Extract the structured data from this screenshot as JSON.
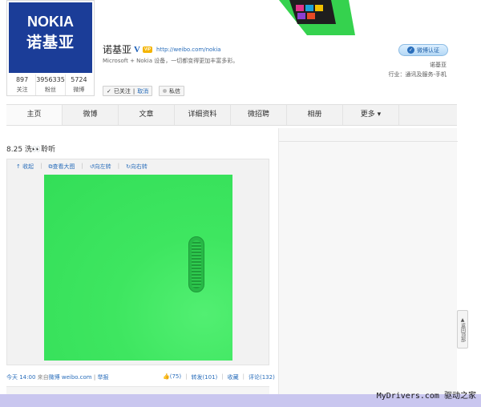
{
  "profile": {
    "logo_en": "NOKIA",
    "logo_cn": "诺基亚",
    "name": "诺基亚",
    "verified_icon": "V",
    "vip_label": "VIP",
    "url": "http://weibo.com/nokia",
    "description": "Microsoft + Nokia 设备，一切都变得更加丰富多彩。",
    "stats": [
      {
        "num": "897",
        "label": "关注"
      },
      {
        "num": "3956335",
        "label": "粉丝"
      },
      {
        "num": "5724",
        "label": "微博"
      }
    ],
    "follow_label": "已关注",
    "cancel_label": "取消",
    "message_label": "私信",
    "verify_badge": "微博认证",
    "right_name": "诺基亚",
    "industry": "行业：通讯及服务-手机"
  },
  "nav": {
    "items": [
      "主页",
      "微博",
      "文章",
      "详细资料",
      "微招聘",
      "相册",
      "更多 ▾"
    ]
  },
  "post": {
    "text": "8.25 洗👀聆听",
    "tools": [
      "收起",
      "查看大图",
      "向左转",
      "向右转"
    ],
    "time": "今天 14:00",
    "source_prefix": "来自",
    "source": "微博 weibo.com",
    "report": "举报",
    "like": "(75)",
    "repost": "转发(101)",
    "favorite": "收藏",
    "comment": "评论(132)"
  },
  "back_to_top": "返回顶部",
  "watermark": {
    "site": "MyDrivers.com",
    "cn": "驱动之家"
  },
  "colors": {
    "accent": "#2a6ebb",
    "logo_bg": "#1b3d98",
    "phone_green": "#3ee660"
  }
}
